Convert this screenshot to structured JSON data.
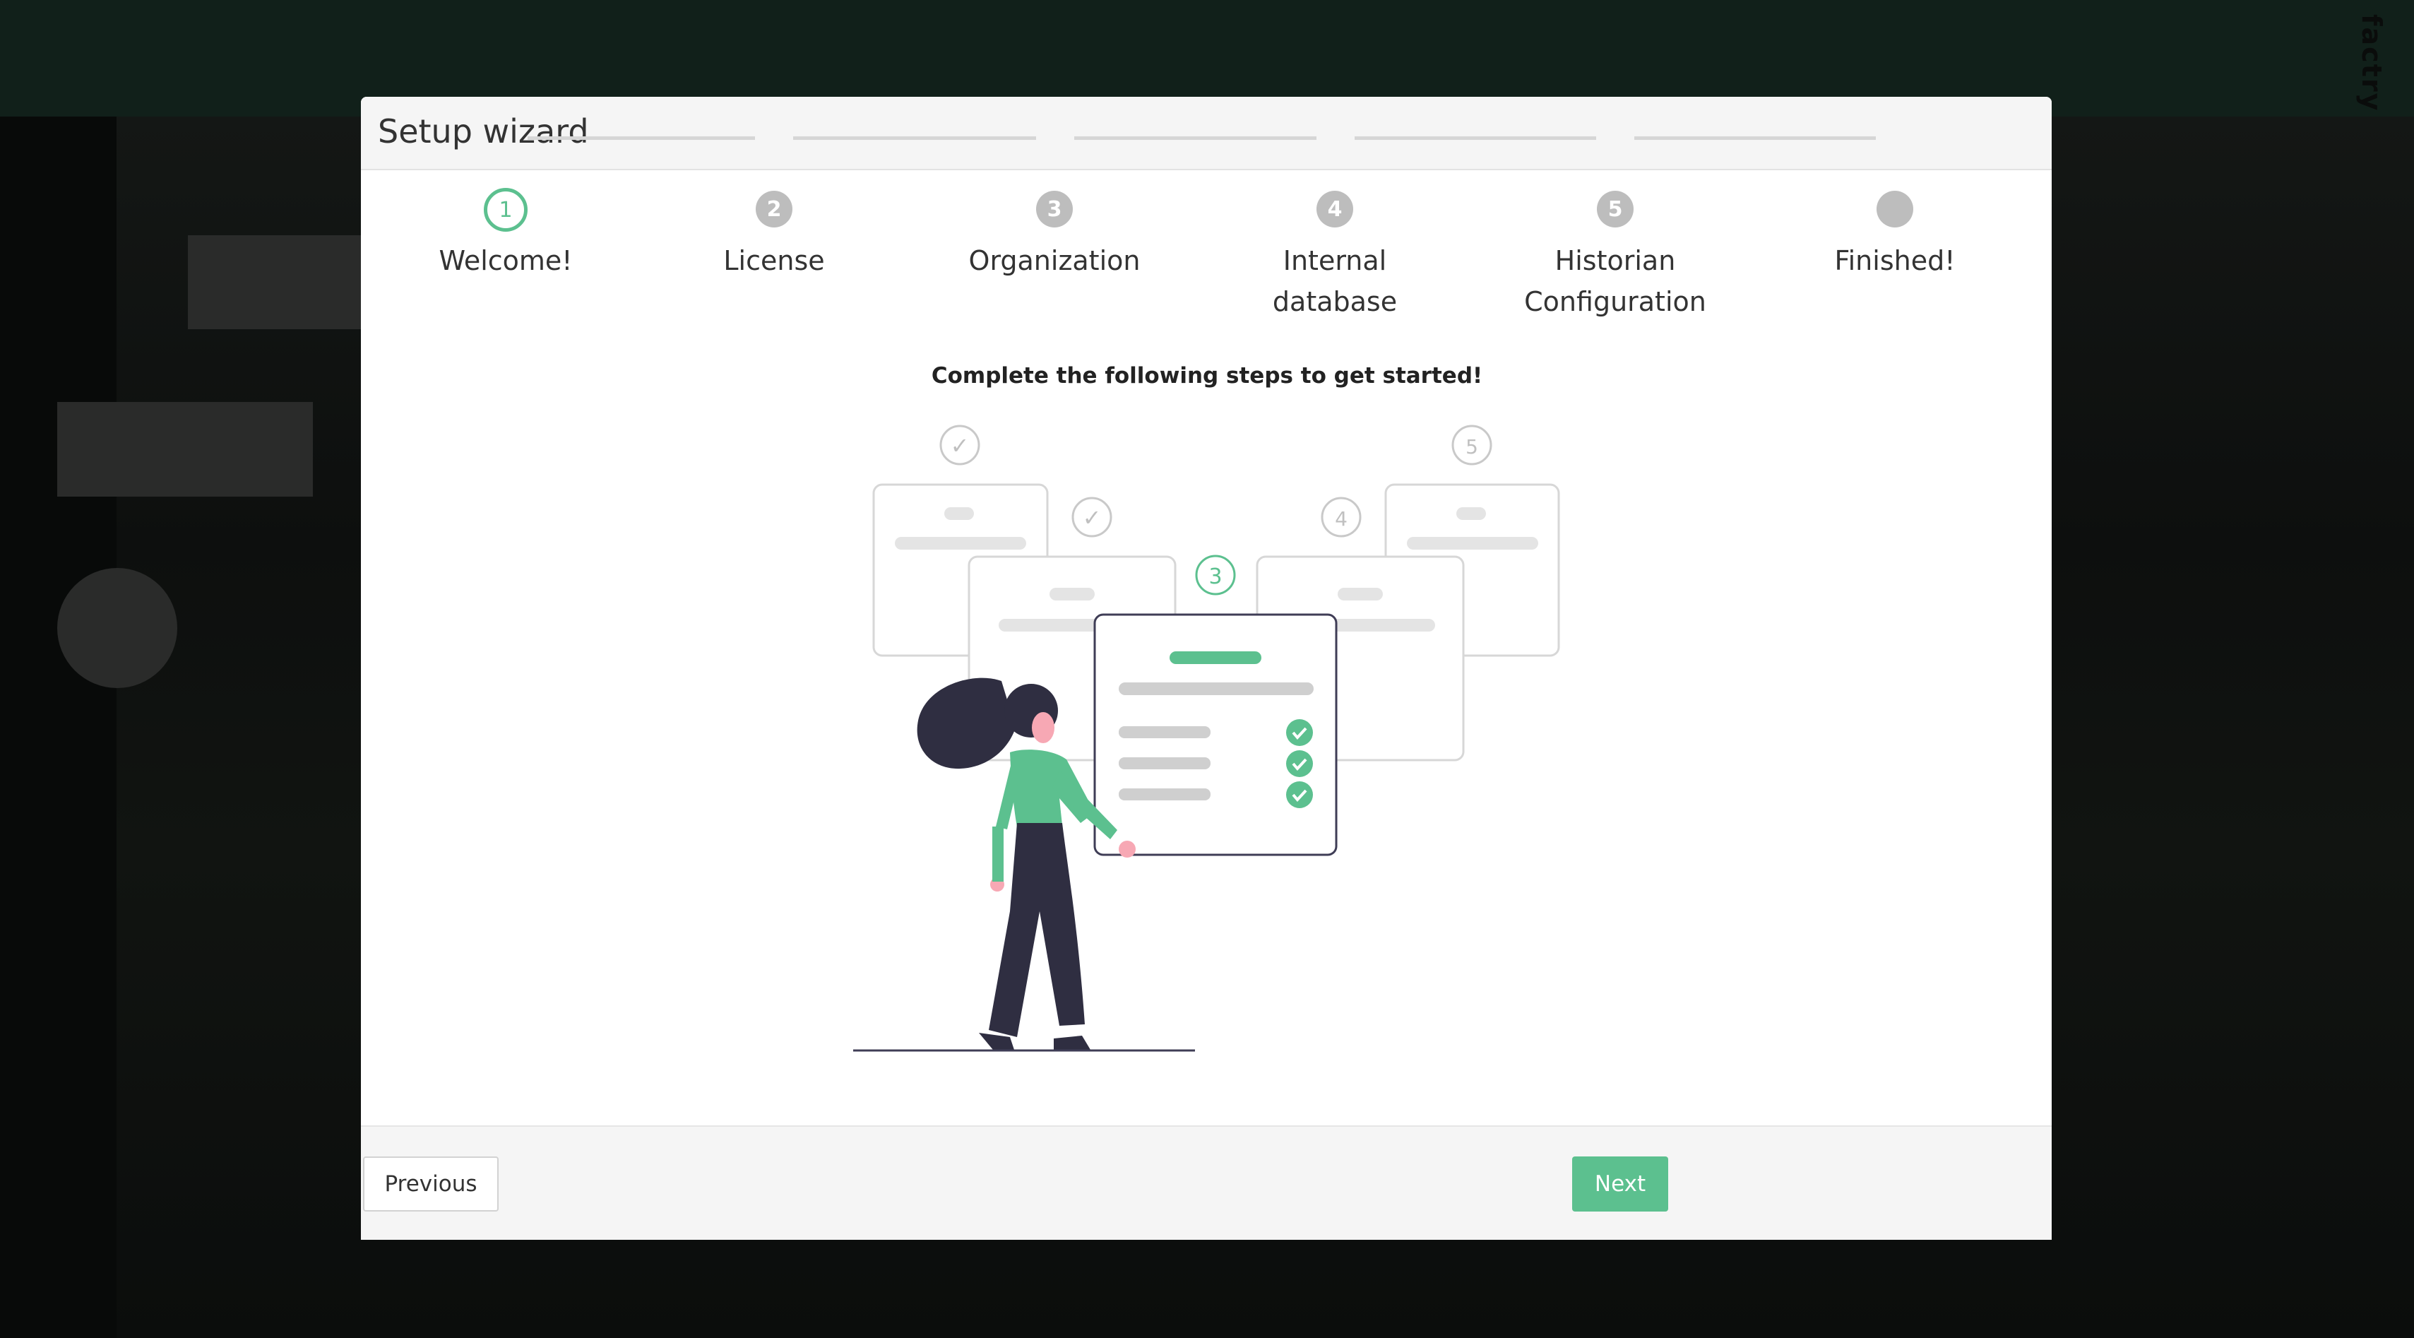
{
  "background": {
    "brand": "factry"
  },
  "modal": {
    "title": "Setup wizard",
    "intro": "Complete the following steps to get started!"
  },
  "steps": [
    {
      "number": "1",
      "label": "Welcome!",
      "state": "active"
    },
    {
      "number": "2",
      "label": "License",
      "state": "pending"
    },
    {
      "number": "3",
      "label": "Organization",
      "state": "pending"
    },
    {
      "number": "4",
      "label": "Internal database",
      "state": "pending"
    },
    {
      "number": "5",
      "label": "Historian Configuration",
      "state": "pending"
    },
    {
      "number": "",
      "label": "Finished!",
      "state": "pending"
    }
  ],
  "illustration": {
    "done_mark": "✓",
    "step_3": "3",
    "step_4": "4",
    "step_5": "5"
  },
  "footer": {
    "previous_label": "Previous",
    "next_label": "Next"
  },
  "colors": {
    "accent": "#5cc08f",
    "step_inactive": "#bdbdbd",
    "figure_dark": "#2f2e41",
    "skin": "#f7a8b4"
  }
}
